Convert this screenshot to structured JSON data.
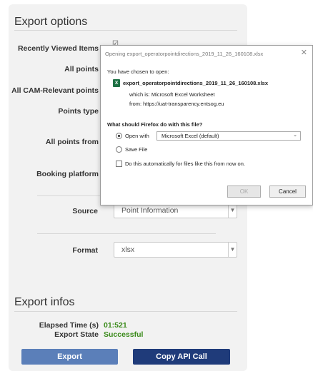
{
  "export_options": {
    "title": "Export options",
    "rows": [
      {
        "label": "Recently Viewed Items"
      },
      {
        "label": "All points"
      },
      {
        "label": "All CAM-Relevant points"
      },
      {
        "label": "Points type"
      },
      {
        "label": "All points from"
      },
      {
        "label": "Booking platform"
      }
    ],
    "source": {
      "label": "Source",
      "value": "Point Information"
    },
    "format": {
      "label": "Format",
      "value": "xlsx"
    },
    "checked_glyph": "☑"
  },
  "export_infos": {
    "title": "Export infos",
    "elapsed_label": "Elapsed Time (s)",
    "elapsed_value": "01:521",
    "state_label": "Export State",
    "state_value": "Successful"
  },
  "buttons": {
    "export": "Export",
    "copy_api": "Copy API Call"
  },
  "dialog": {
    "title": "Opening export_operatorpointdirections_2019_11_26_160108.xlsx",
    "close": "✕",
    "intro": "You have chosen to open:",
    "filename": "export_operatorpointdirections_2019_11_26_160108.xlsx",
    "file_icon_letter": "X",
    "which_is": "which is: Microsoft Excel Worksheet",
    "from": "from: https://uat-transparency.entsog.eu",
    "question": "What should Firefox do with this file?",
    "open_with_label": "Open with",
    "open_with_value": "Microsoft Excel (default)",
    "save_file_label": "Save File",
    "auto_label": "Do this automatically for files like this from now on.",
    "ok_label": "OK",
    "cancel_label": "Cancel"
  },
  "colors": {
    "success": "#3a8a1a",
    "export_button": "#5b7fb9",
    "copy_button": "#1f3b7a",
    "excel_icon": "#1e7145"
  }
}
